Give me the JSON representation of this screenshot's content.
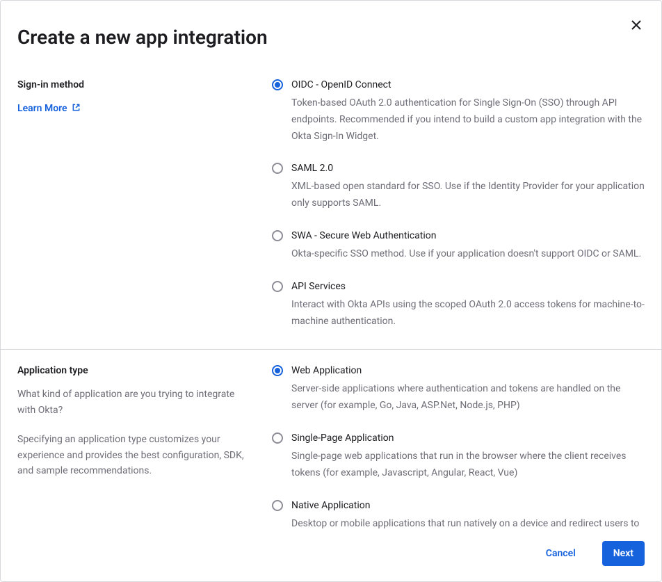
{
  "dialog": {
    "title": "Create a new app integration",
    "close_label": "Close"
  },
  "sections": {
    "sign_in": {
      "heading": "Sign-in method",
      "learn_more": "Learn More",
      "options": {
        "oidc": {
          "title": "OIDC - OpenID Connect",
          "desc": "Token-based OAuth 2.0 authentication for Single Sign-On (SSO) through API endpoints. Recommended if you intend to build a custom app integration with the Okta Sign-In Widget.",
          "selected": true
        },
        "saml": {
          "title": "SAML 2.0",
          "desc": "XML-based open standard for SSO. Use if the Identity Provider for your application only supports SAML.",
          "selected": false
        },
        "swa": {
          "title": "SWA - Secure Web Authentication",
          "desc": "Okta-specific SSO method. Use if your application doesn't support OIDC or SAML.",
          "selected": false
        },
        "api": {
          "title": "API Services",
          "desc": "Interact with Okta APIs using the scoped OAuth 2.0 access tokens for machine-to-machine authentication.",
          "selected": false
        }
      }
    },
    "app_type": {
      "heading": "Application type",
      "help1": "What kind of application are you trying to integrate with Okta?",
      "help2": "Specifying an application type customizes your experience and provides the best configuration, SDK, and sample recommendations.",
      "options": {
        "web": {
          "title": "Web Application",
          "desc": "Server-side applications where authentication and tokens are handled on the server (for example, Go, Java, ASP.Net, Node.js, PHP)",
          "selected": true
        },
        "spa": {
          "title": "Single-Page Application",
          "desc": "Single-page web applications that run in the browser where the client receives tokens (for example, Javascript, Angular, React, Vue)",
          "selected": false
        },
        "native": {
          "title": "Native Application",
          "desc": "Desktop or mobile applications that run natively on a device and redirect users to a non-HTTP callback (for example, iOS, Android, React Native)",
          "selected": false
        }
      }
    }
  },
  "footer": {
    "cancel": "Cancel",
    "next": "Next"
  }
}
